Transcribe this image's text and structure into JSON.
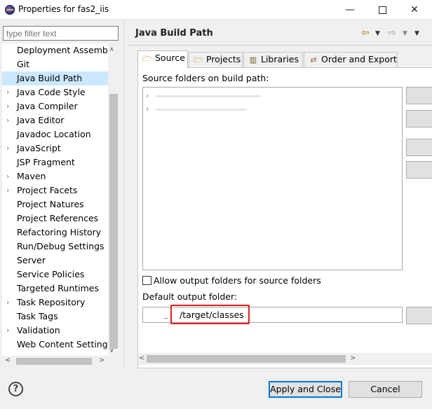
{
  "window": {
    "title": "Properties for fas2_iis"
  },
  "filter": {
    "placeholder": "type filter text"
  },
  "tree_items": [
    {
      "label": "Deployment Assembly",
      "expandable": false,
      "selected": false
    },
    {
      "label": "Git",
      "expandable": false,
      "selected": false
    },
    {
      "label": "Java Build Path",
      "expandable": false,
      "selected": true
    },
    {
      "label": "Java Code Style",
      "expandable": true,
      "selected": false
    },
    {
      "label": "Java Compiler",
      "expandable": true,
      "selected": false
    },
    {
      "label": "Java Editor",
      "expandable": true,
      "selected": false
    },
    {
      "label": "Javadoc Location",
      "expandable": false,
      "selected": false
    },
    {
      "label": "JavaScript",
      "expandable": true,
      "selected": false
    },
    {
      "label": "JSP Fragment",
      "expandable": false,
      "selected": false
    },
    {
      "label": "Maven",
      "expandable": true,
      "selected": false
    },
    {
      "label": "Project Facets",
      "expandable": true,
      "selected": false
    },
    {
      "label": "Project Natures",
      "expandable": false,
      "selected": false
    },
    {
      "label": "Project References",
      "expandable": false,
      "selected": false
    },
    {
      "label": "Refactoring History",
      "expandable": false,
      "selected": false
    },
    {
      "label": "Run/Debug Settings",
      "expandable": false,
      "selected": false
    },
    {
      "label": "Server",
      "expandable": false,
      "selected": false
    },
    {
      "label": "Service Policies",
      "expandable": false,
      "selected": false
    },
    {
      "label": "Targeted Runtimes",
      "expandable": false,
      "selected": false
    },
    {
      "label": "Task Repository",
      "expandable": true,
      "selected": false
    },
    {
      "label": "Task Tags",
      "expandable": false,
      "selected": false
    },
    {
      "label": "Validation",
      "expandable": true,
      "selected": false
    },
    {
      "label": "Web Content Settings",
      "expandable": false,
      "selected": false
    }
  ],
  "page": {
    "title": "Java Build Path",
    "tabs": [
      {
        "label": "Source",
        "icon": "source-folder-icon",
        "active": true
      },
      {
        "label": "Projects",
        "icon": "projects-icon",
        "active": false
      },
      {
        "label": "Libraries",
        "icon": "libraries-icon",
        "active": false
      },
      {
        "label": "Order and Export",
        "icon": "order-export-icon",
        "active": false
      }
    ],
    "source_label": "Source folders on build path:",
    "allow_output_label": "Allow output folders for source folders",
    "allow_output_checked": false,
    "default_output_label": "Default output folder:",
    "default_output_value": "/target/classes",
    "default_output_prefix": "_"
  },
  "buttons": {
    "apply": "Apply and Close",
    "cancel": "Cancel"
  },
  "colors": {
    "selection": "#cce8ff",
    "highlight_box": "#e02020",
    "default_button_border": "#0078d7"
  }
}
